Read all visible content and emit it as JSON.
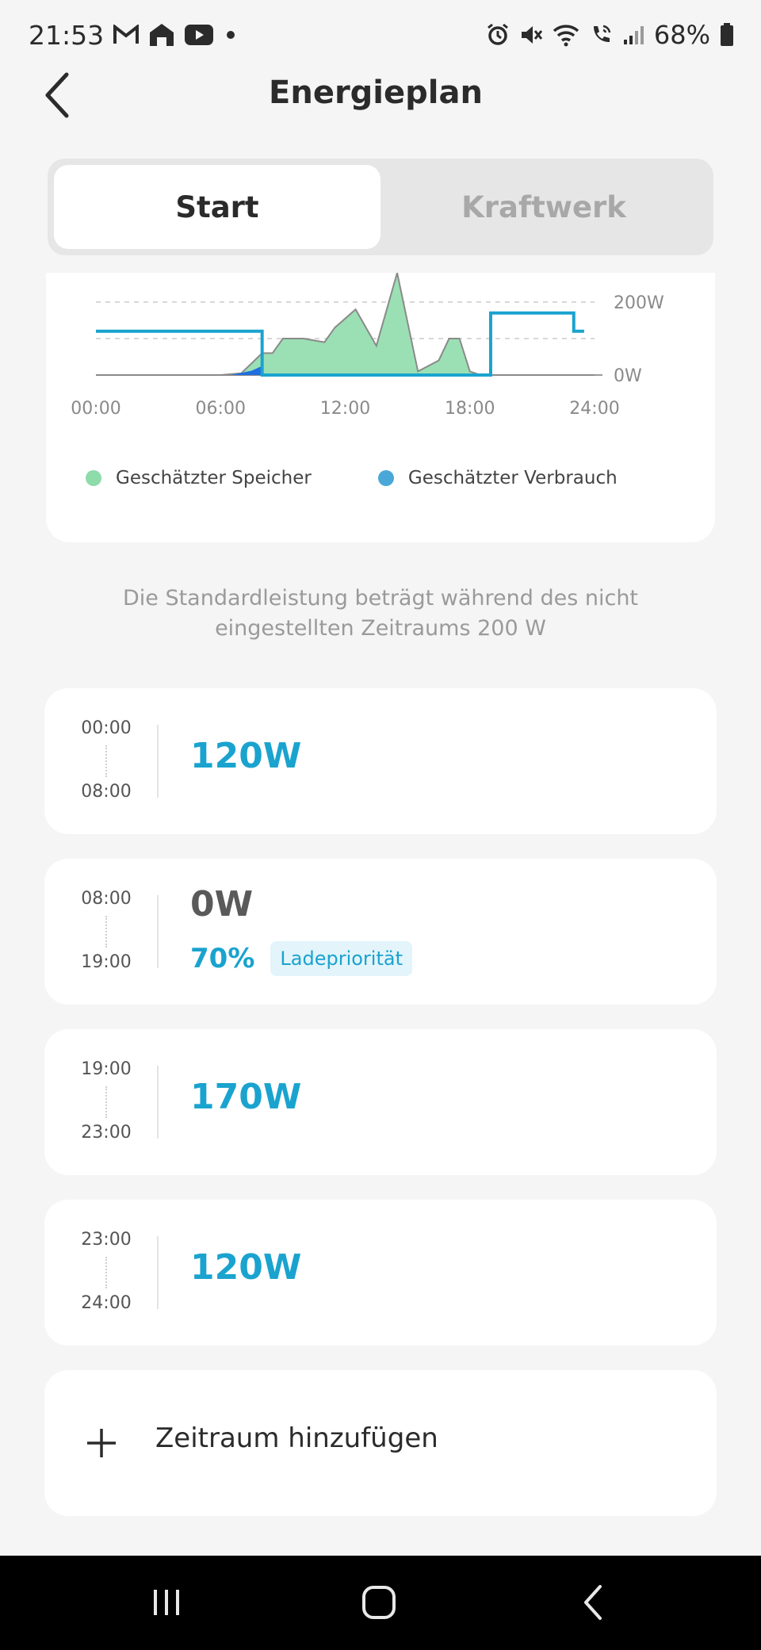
{
  "status_bar": {
    "time": "21:53",
    "battery": "68%",
    "left_icons": [
      "gmail-icon",
      "home-icon",
      "youtube-icon",
      "dot-icon"
    ],
    "right_icons": [
      "alarm-icon",
      "mute-icon",
      "wifi-icon",
      "wifi-call-icon",
      "signal-icon",
      "battery-icon"
    ]
  },
  "header": {
    "title": "Energieplan",
    "back_icon": "chevron-left-icon"
  },
  "tabs": [
    {
      "label": "Start",
      "active": true
    },
    {
      "label": "Kraftwerk",
      "active": false
    }
  ],
  "chart_data": {
    "type": "area",
    "x_ticks": [
      "00:00",
      "06:00",
      "12:00",
      "18:00",
      "24:00"
    ],
    "y_ticks": [
      "200W",
      "0W"
    ],
    "xlim": [
      0,
      24
    ],
    "ylim": [
      0,
      200
    ],
    "series": [
      {
        "name": "Geschätzter Speicher",
        "color": "#9be0b4",
        "type": "area",
        "x": [
          0,
          6,
          7,
          8,
          8.5,
          9,
          9.5,
          10,
          11,
          11.5,
          12.5,
          13.5,
          14.5,
          15.5,
          16.5,
          17,
          17.5,
          18,
          18.5,
          19,
          20,
          24
        ],
        "y": [
          0,
          0,
          5,
          60,
          60,
          100,
          100,
          100,
          90,
          130,
          180,
          80,
          280,
          10,
          40,
          100,
          100,
          10,
          0,
          0,
          0,
          0
        ]
      },
      {
        "name": "Geschätzter Verbrauch",
        "color": "#1aa3cf",
        "type": "step",
        "x": [
          0,
          8,
          8,
          19,
          19,
          23,
          23,
          23.5
        ],
        "y": [
          120,
          120,
          0,
          0,
          170,
          170,
          120,
          120
        ]
      }
    ],
    "legend": [
      "Geschätzter Speicher",
      "Geschätzter Verbrauch"
    ],
    "legend_colors": [
      "#8ddcaa",
      "#4aa8d8"
    ]
  },
  "info_note": "Die Standardleistung beträgt während des nicht eingestellten Zeitraums 200 W",
  "slots": [
    {
      "start": "00:00",
      "end": "08:00",
      "power": "120W"
    },
    {
      "start": "08:00",
      "end": "19:00",
      "power": "0W",
      "percent": "70%",
      "badge": "Ladepriorität"
    },
    {
      "start": "19:00",
      "end": "23:00",
      "power": "170W"
    },
    {
      "start": "23:00",
      "end": "24:00",
      "power": "120W"
    }
  ],
  "add_slot": {
    "label": "Zeitraum hinzufügen",
    "icon": "plus-icon"
  },
  "nav": {
    "recent_icon": "recent-apps-icon",
    "home_icon": "home-button-icon",
    "back_icon": "back-icon"
  }
}
